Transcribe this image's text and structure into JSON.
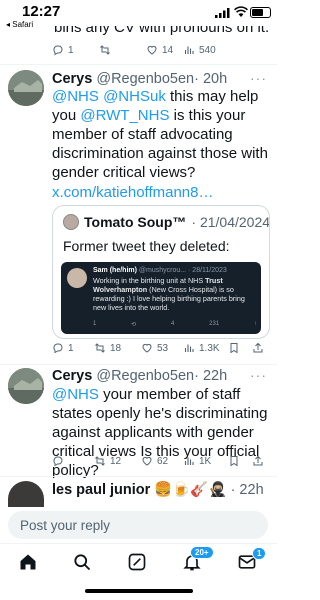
{
  "status_bar": {
    "time": "12:27",
    "back_app": "◂ Safari"
  },
  "previous_tweet": {
    "tail_text": "bins any CV with pronouns on it.",
    "reply_count": "1",
    "retweet_count": "",
    "like_count": "14",
    "views_count": "540"
  },
  "tweets": [
    {
      "name": "Cerys",
      "handle": "@Regenbo5en",
      "time": "· 20h",
      "more": "···",
      "body": {
        "m1": "@NHS",
        "m2": "@NHSuk",
        "t1": " this may help you ",
        "m3": "@RWT_NHS",
        "t2": " is this your member of staff advocating discrimination against those with gender critical views?",
        "link": "x.com/katiehoffmann8…"
      },
      "quote": {
        "author": "Tomato Soup™",
        "date": "· 21/04/2024",
        "text": "Former tweet they deleted:",
        "image": {
          "name": "Sam (he/him)",
          "handle": "@mushycrou... · 28/11/2023",
          "text_a": "Working in the birthing unit at NHS ",
          "text_b": "Trust Wolverhampton",
          "text_c": " (New Cross Hospital) is so rewarding :) I love helping birthing parents bring new lives into the world.",
          "actions": [
            "1",
            "",
            "4",
            "231",
            ""
          ]
        }
      },
      "stats": {
        "reply": "1",
        "retweet": "18",
        "like": "53",
        "views": "1.3K"
      }
    },
    {
      "name": "Cerys",
      "handle": "@Regenbo5en",
      "time": "· 22h",
      "more": "···",
      "body": {
        "m1": "@NHS",
        "t1": " your member of staff states openly he's discriminating against applicants with gender critical views Is this your official policy?"
      },
      "stats": {
        "reply": "",
        "retweet": "12",
        "like": "62",
        "views": "1K"
      }
    },
    {
      "name": "les paul junior 🍔🍺🎸🥷🏼",
      "time": "· 22h"
    }
  ],
  "reply_bar": {
    "placeholder": "Post your reply"
  },
  "tabbar": {
    "items": [
      "home-icon",
      "search-icon",
      "grok-icon",
      "notifications-icon",
      "messages-icon"
    ],
    "notif_badge": "20+",
    "messages_badge": "1"
  },
  "colors": {
    "accent": "#1d9bf0",
    "text": "#0f1419",
    "muted": "#536471"
  }
}
